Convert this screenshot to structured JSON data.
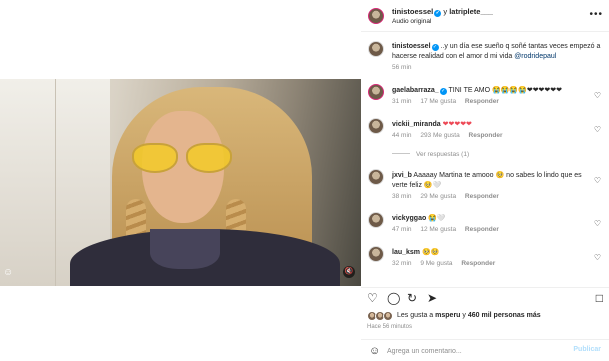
{
  "post": {
    "author": "tinistoessel",
    "collab_connector": "y",
    "collaborator": "latriplete___",
    "audio": "Audio original",
    "more": "•••"
  },
  "caption": {
    "user": "tinistoessel",
    "text": "..y un día ese sueño q soñé tantas veces empezó a hacerse realidad con el amor d mi vida",
    "mention": "@rodridepaul",
    "time": "56 min"
  },
  "comments": [
    {
      "user": "gaelabarraza_",
      "verified": true,
      "text": "TINI TE AMO 😭😭😭😭❤❤❤❤❤❤",
      "time": "31 min",
      "likes": "17 Me gusta",
      "reply": "Responder"
    },
    {
      "user": "vickii_miranda",
      "verified": false,
      "text": "❤❤❤❤❤",
      "time": "44 min",
      "likes": "293 Me gusta",
      "reply": "Responder"
    },
    {
      "user": "jxvi_b",
      "verified": false,
      "text": "Aaaaay Martina te amooo 🥺 no sabes lo lindo que es verte feliz 🥺🤍",
      "time": "38 min",
      "likes": "29 Me gusta",
      "reply": "Responder"
    },
    {
      "user": "vickyggao",
      "verified": false,
      "text": "😭🤍",
      "time": "47 min",
      "likes": "12 Me gusta",
      "reply": "Responder"
    },
    {
      "user": "lau_ksm",
      "verified": false,
      "text": "🥺🥺",
      "time": "32 min",
      "likes": "9 Me gusta",
      "reply": "Responder"
    }
  ],
  "view_replies": "Ver respuestas (1)",
  "likes": {
    "prefix": "Les gusta a",
    "first_user": "msperu",
    "connector": "y",
    "count": "460 mil personas más",
    "ago": "Hace 56 minutos"
  },
  "add_comment": {
    "placeholder": "Agrega un comentario...",
    "post_label": "Publicar"
  },
  "icons": {
    "like": "heart-icon",
    "comment": "comment-icon",
    "share": "share-icon",
    "repost": "repost-icon",
    "save": "bookmark-icon",
    "emoji": "emoji-icon"
  },
  "colors": {
    "link": "#00376b",
    "meta": "#8e8e8e",
    "publish_disabled": "#b2dffc",
    "verified": "#0095f6"
  }
}
